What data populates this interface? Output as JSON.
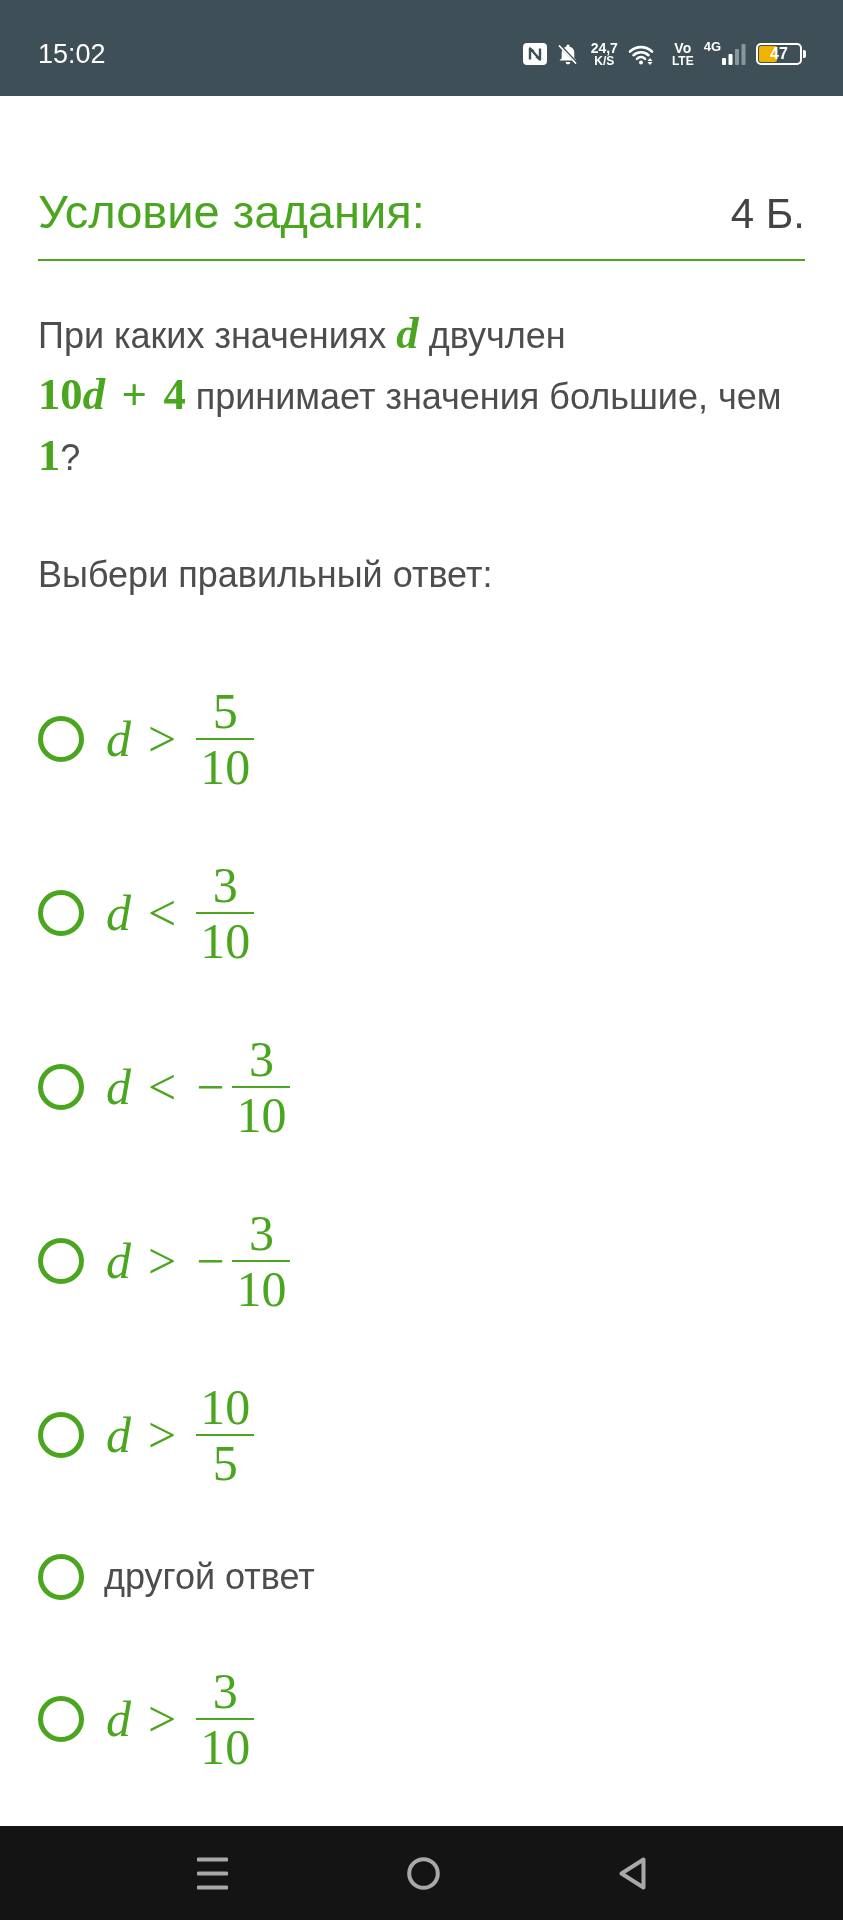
{
  "status_bar": {
    "time": "15:02",
    "network_speed": [
      "24,7",
      "K/S"
    ],
    "volte": [
      "Vo",
      "LTE"
    ],
    "network_type": "4G",
    "battery": "47"
  },
  "task_header": {
    "title": "Условие задания:",
    "points": "4 Б."
  },
  "question": [
    {
      "kind": "text",
      "text": "При каких значениях "
    },
    {
      "kind": "math",
      "text": "d"
    },
    {
      "kind": "text",
      "text": " двучлен\n"
    },
    {
      "kind": "math",
      "text": "10d + 4"
    },
    {
      "kind": "text",
      "text": " принимает значения большие, чем "
    },
    {
      "kind": "math",
      "text": "1"
    },
    {
      "kind": "text",
      "text": "?"
    }
  ],
  "prompt": "Выбери правильный ответ:",
  "options": [
    {
      "kind": "fraction",
      "lhs": "d",
      "relation": ">",
      "numerator": "5",
      "denominator": "10",
      "selected": false
    },
    {
      "kind": "fraction",
      "lhs": "d",
      "relation": "<",
      "numerator": "3",
      "denominator": "10",
      "selected": false
    },
    {
      "kind": "fraction",
      "lhs": "d",
      "relation": "<",
      "sign": "−",
      "numerator": "3",
      "denominator": "10",
      "selected": false
    },
    {
      "kind": "fraction",
      "lhs": "d",
      "relation": ">",
      "sign": "−",
      "numerator": "3",
      "denominator": "10",
      "selected": false
    },
    {
      "kind": "fraction",
      "lhs": "d",
      "relation": ">",
      "numerator": "10",
      "denominator": "5",
      "selected": false
    },
    {
      "kind": "text",
      "text": "другой ответ",
      "selected": false
    },
    {
      "kind": "fraction",
      "lhs": "d",
      "relation": ">",
      "numerator": "3",
      "denominator": "10",
      "selected": false
    }
  ]
}
